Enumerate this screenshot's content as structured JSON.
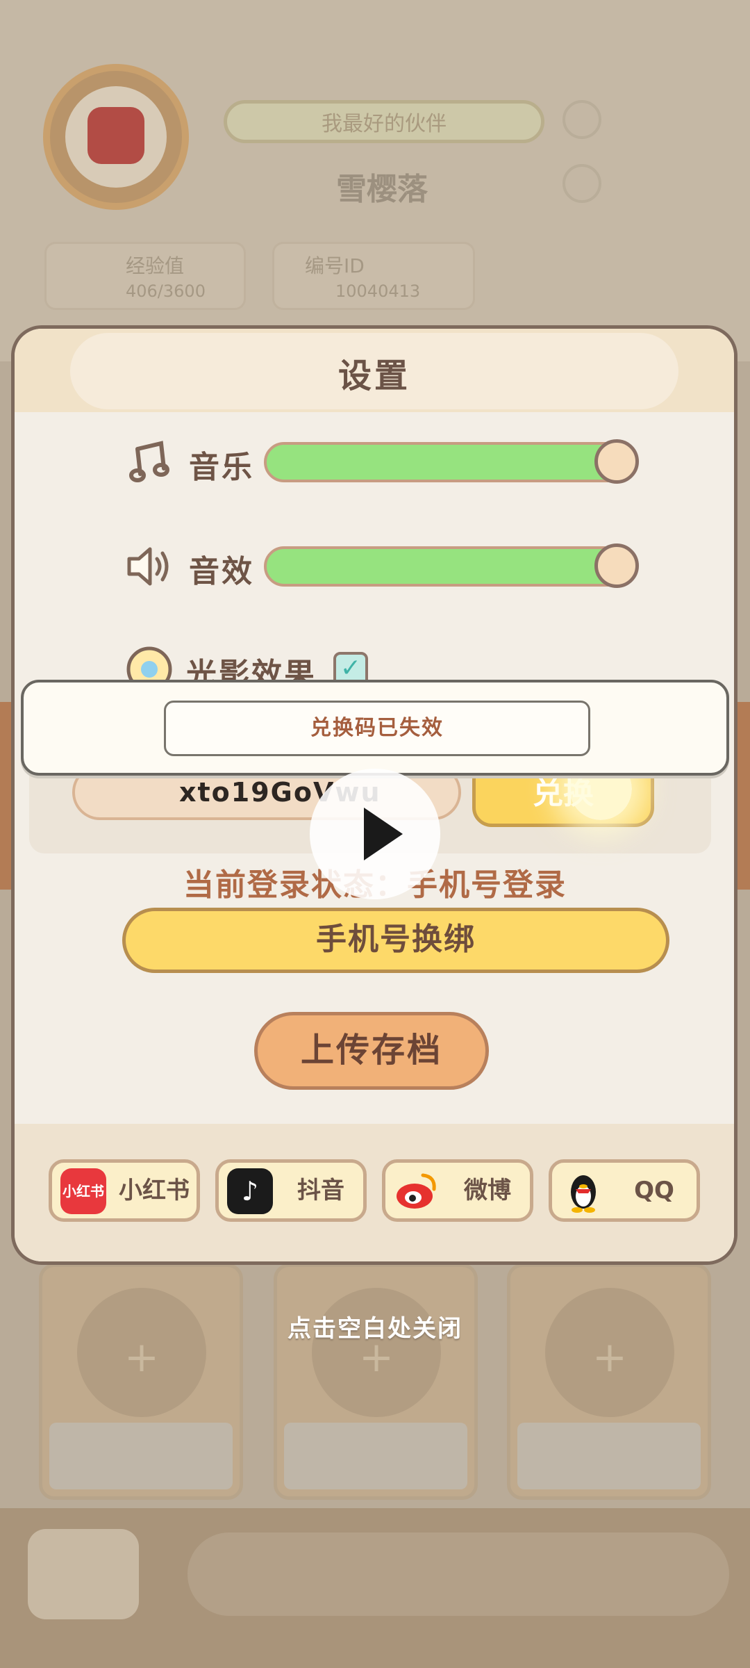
{
  "background": {
    "title_badge": "我最好的伙伴",
    "player_name": "雪樱落",
    "stat_cards": [
      {
        "label": "经验值",
        "value": "406/3600"
      },
      {
        "label": "编号ID",
        "value": "10040413"
      }
    ]
  },
  "settings": {
    "title": "设置",
    "music": {
      "label": "音乐",
      "level_percent": 100,
      "icon": "music-note-icon"
    },
    "sound_effects": {
      "label": "音效",
      "level_percent": 100,
      "icon": "speaker-icon"
    },
    "lighting": {
      "label": "光影效果",
      "checked": true,
      "icon": "sun-icon"
    },
    "redeem": {
      "code_value": "xto19GoVwu",
      "button_label": "兑换"
    },
    "login_status": "当前登录状态：手机号登录",
    "rebind_phone_label": "手机号换绑",
    "upload_save_label": "上传存档",
    "social": [
      {
        "label": "小红书",
        "logo_text": "小红书",
        "color": "#e8383d"
      },
      {
        "label": "抖音",
        "logo_text": "♪",
        "color": "#1b1b1b"
      },
      {
        "label": "微博",
        "logo_text": "◉",
        "color": "#f6f0e0"
      },
      {
        "label": "QQ",
        "logo_text": "🐧",
        "color": "#f6f0e0"
      }
    ]
  },
  "toast": {
    "message": "兑换码已失效",
    "ghost_text": "兑换码已失效"
  },
  "tap_to_close": "点击空白处关闭",
  "colors": {
    "slider_fill": "#96e37f",
    "primary_yellow": "#fdd969",
    "orange": "#f1b178",
    "text_brown": "#6e5446"
  }
}
